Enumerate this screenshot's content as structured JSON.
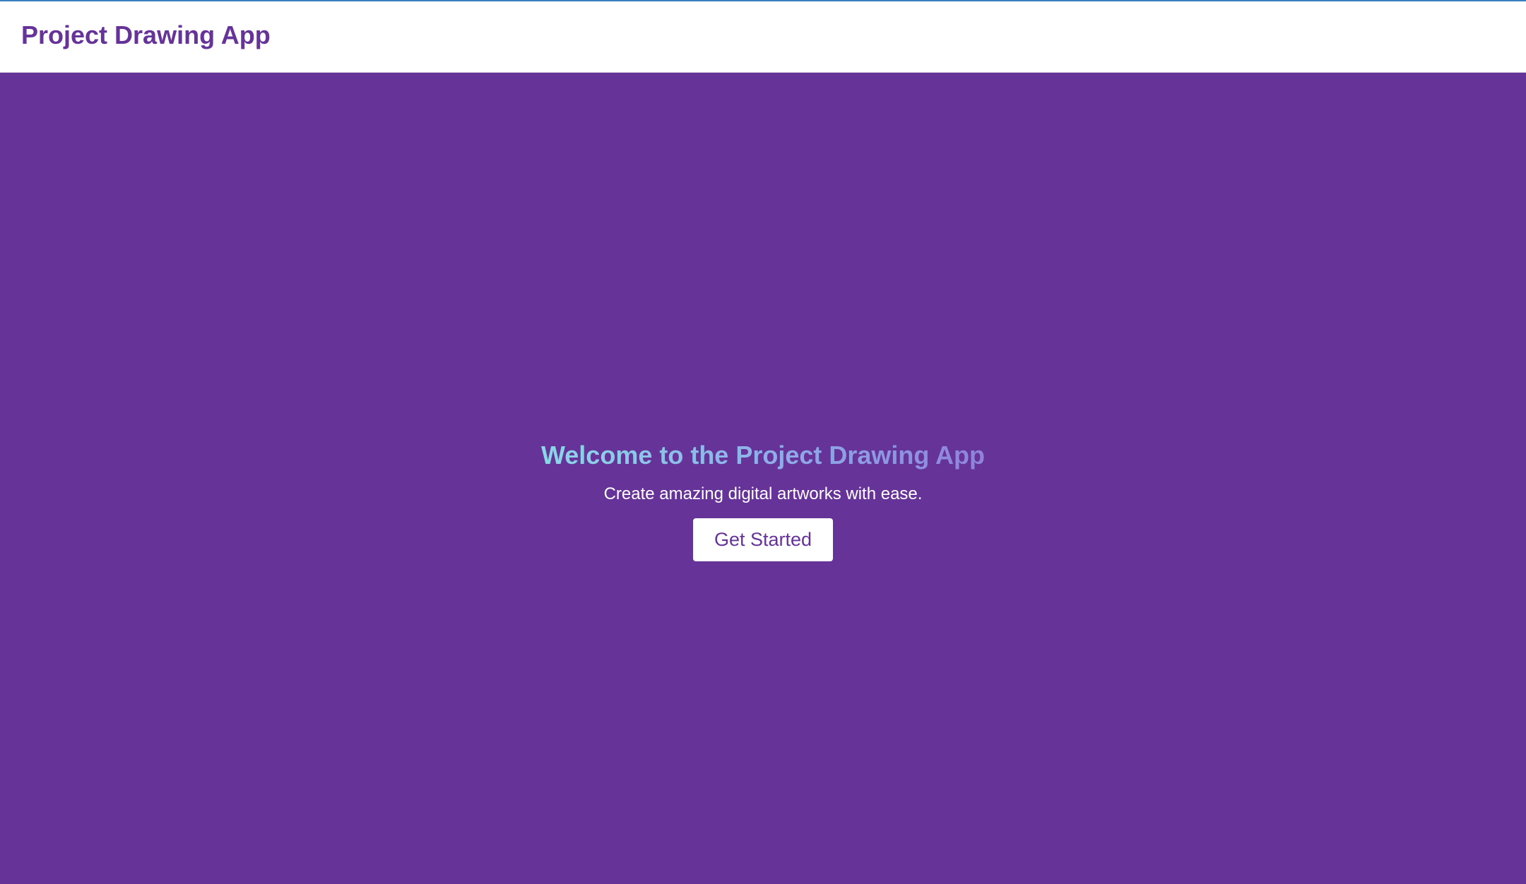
{
  "header": {
    "title": "Project Drawing App"
  },
  "hero": {
    "heading": "Welcome to the Project Drawing App",
    "subtitle": "Create amazing digital artworks with ease.",
    "cta_label": "Get Started"
  },
  "colors": {
    "background": "#663399",
    "header_background": "#ffffff",
    "brand": "#663399",
    "heading_gradient_start": "#8ad8e6",
    "heading_gradient_end": "#8f82dc",
    "button_background": "#ffffff",
    "button_text": "#663399",
    "subtitle_text": "#ffffff"
  }
}
